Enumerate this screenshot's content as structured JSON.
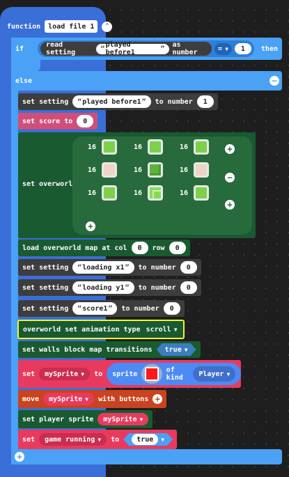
{
  "function_block": {
    "keyword": "function",
    "name": "load file 1"
  },
  "if_block": {
    "keyword": "if",
    "read_label": "read setting",
    "setting_name": "played before1",
    "as_number_label": "as number",
    "operator": "=",
    "compare_value": "1",
    "then_label": "then"
  },
  "else_label": "else",
  "else_blocks": {
    "set_setting_1": {
      "prefix": "set setting",
      "name": "played before1",
      "mid": "to number",
      "value": "1"
    },
    "set_score": {
      "label": "set score to",
      "value": "0"
    },
    "set_overworld": {
      "label": "set overworld",
      "cells": [
        {
          "num": "16",
          "tile": "plain"
        },
        {
          "num": "16",
          "tile": "plain"
        },
        {
          "num": "16",
          "tile": "plain"
        },
        {
          "num": "16",
          "tile": "sand"
        },
        {
          "num": "16",
          "tile": "dark"
        },
        {
          "num": "16",
          "tile": "sand"
        },
        {
          "num": "16",
          "tile": "plain"
        },
        {
          "num": "16",
          "tile": "light"
        },
        {
          "num": "16",
          "tile": "plain"
        }
      ]
    },
    "load_map": {
      "prefix": "load overworld map at col",
      "col": "0",
      "mid": "row",
      "row": "0"
    },
    "set_setting_2": {
      "prefix": "set setting",
      "name": "loading x1",
      "mid": "to number",
      "value": "0"
    },
    "set_setting_3": {
      "prefix": "set setting",
      "name": "loading y1",
      "mid": "to number",
      "value": "0"
    },
    "set_setting_4": {
      "prefix": "set setting",
      "name": "score1",
      "mid": "to number",
      "value": "0"
    },
    "anim_type": {
      "label": "overworld set animation type",
      "value": "scroll"
    },
    "walls": {
      "label": "set walls block map transitions",
      "value": "true"
    },
    "set_sprite": {
      "set_label": "set",
      "var": "mySprite",
      "to_label": "to",
      "sprite_label": "sprite",
      "kind_label": "of kind",
      "kind": "Player"
    },
    "move_sprite": {
      "label": "move",
      "var": "mySprite",
      "suffix": "with buttons"
    },
    "player_sprite": {
      "label": "set player sprite",
      "var": "mySprite"
    },
    "game_running": {
      "set_label": "set",
      "var": "game running",
      "to_label": "to",
      "value": "true"
    }
  },
  "colors": {
    "function_blue": "#3a6fd8",
    "logic_blue": "#4aa1f5",
    "dark_block": "#3d3d3d",
    "score_pink": "#cf4f7a",
    "overworld_green": "#195a31",
    "sprite_pink": "#e83a5f",
    "move_orange": "#c9431f",
    "sprite_blue": "#4c8bf5"
  },
  "icons": [
    "collapse-icon",
    "minus-icon",
    "plus-icon",
    "caret-down-icon"
  ]
}
